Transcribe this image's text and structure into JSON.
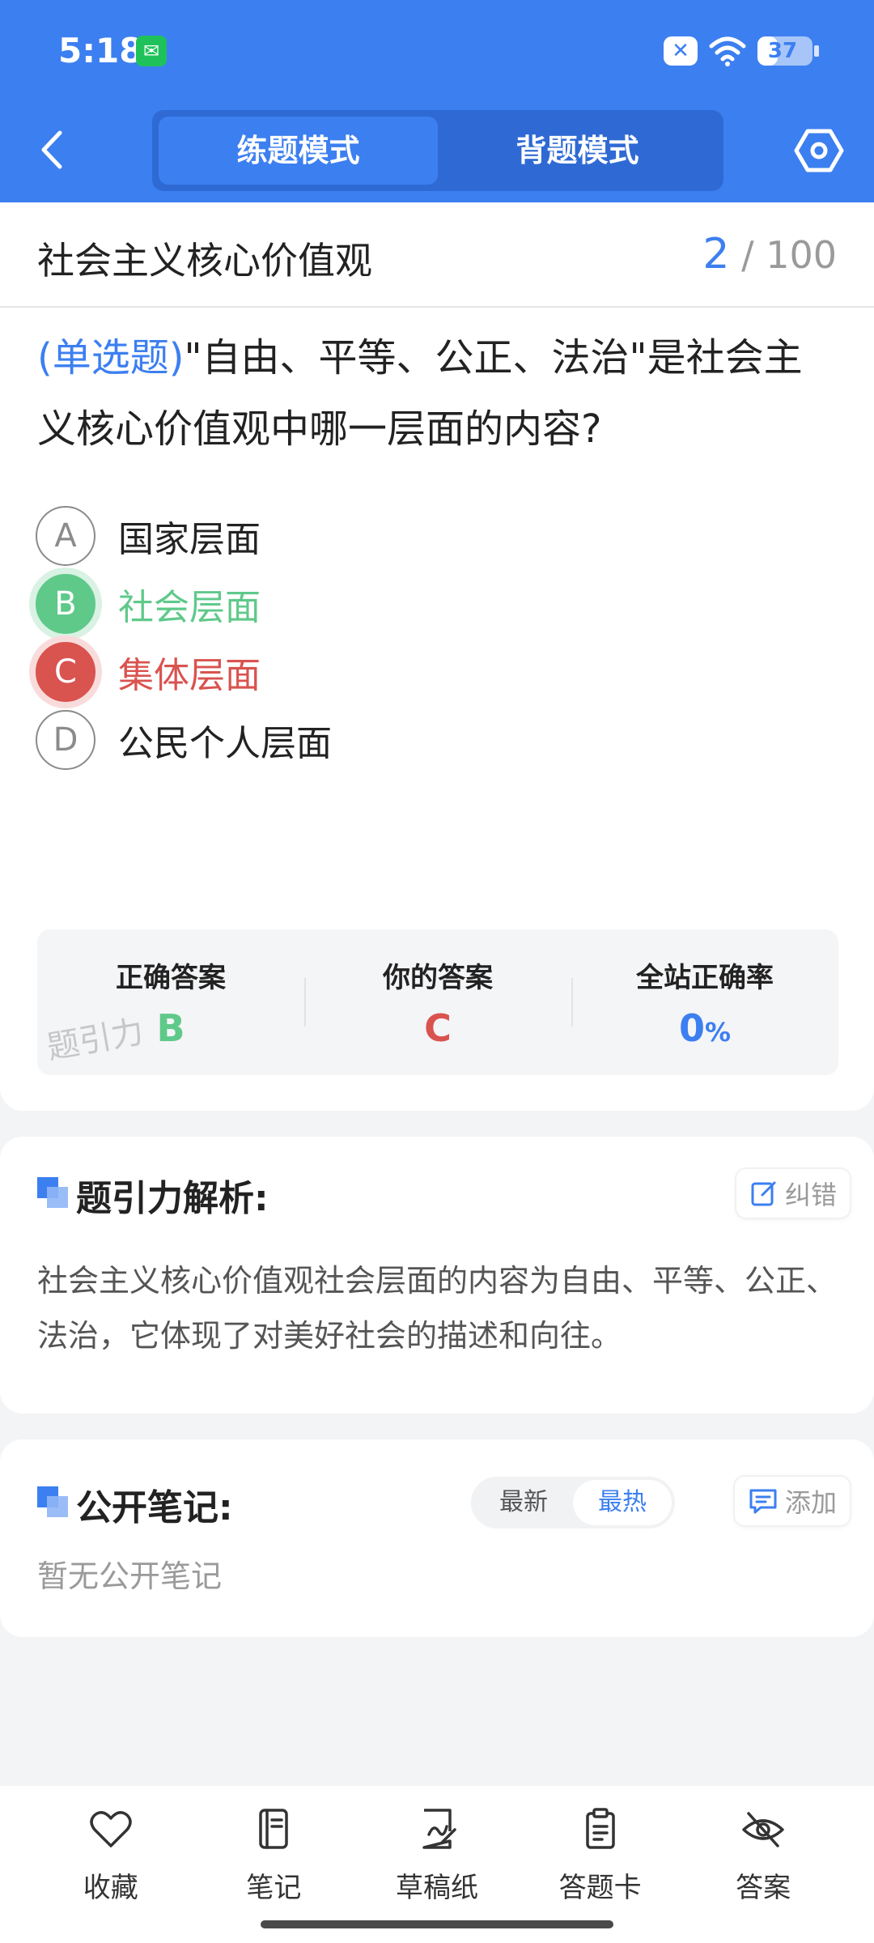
{
  "status_bar": {
    "time": "5:18",
    "battery": "37",
    "battery_level": 0.37
  },
  "header": {
    "modes": [
      "练题模式",
      "背题模式"
    ],
    "active_mode_index": 0
  },
  "question": {
    "chapter": "社会主义核心价值观",
    "current": "2",
    "total": "/ 100",
    "type_label": "(单选题)",
    "stem": "\"自由、平等、公正、法治\"是社会主义核心价值观中哪一层面的内容?",
    "options": [
      {
        "letter": "A",
        "text": "国家层面",
        "state": "normal"
      },
      {
        "letter": "B",
        "text": "社会层面",
        "state": "correct"
      },
      {
        "letter": "C",
        "text": "集体层面",
        "state": "wrong"
      },
      {
        "letter": "D",
        "text": "公民个人层面",
        "state": "normal"
      }
    ]
  },
  "stats": {
    "correct_label": "正确答案",
    "correct_value": "B",
    "yours_label": "你的答案",
    "yours_value": "C",
    "rate_label": "全站正确率",
    "rate_value": "0",
    "rate_unit": "%",
    "watermark": "题引力"
  },
  "analysis": {
    "title": "题引力解析:",
    "report_label": "纠错",
    "text": "社会主义核心价值观社会层面的内容为自由、平等、公正、法治，它体现了对美好社会的描述和向往。"
  },
  "notes": {
    "title": "公开笔记:",
    "sort_options": [
      "最新",
      "最热"
    ],
    "active_sort_index": 1,
    "add_label": "添加",
    "empty_text": "暂无公开笔记"
  },
  "bottom_nav": [
    {
      "label": "收藏",
      "icon": "heart-icon"
    },
    {
      "label": "笔记",
      "icon": "notebook-icon"
    },
    {
      "label": "草稿纸",
      "icon": "draft-paper-icon"
    },
    {
      "label": "答题卡",
      "icon": "answer-sheet-icon"
    },
    {
      "label": "答案",
      "icon": "eye-off-icon"
    }
  ],
  "colors": {
    "primary": "#3c7ff0",
    "correct": "#5fc98a",
    "wrong": "#d9534f"
  }
}
